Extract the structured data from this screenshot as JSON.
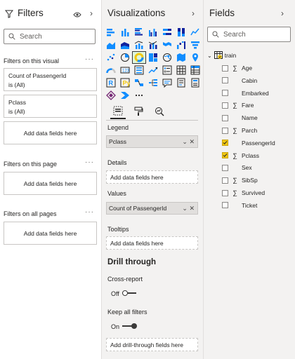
{
  "filters": {
    "title": "Filters",
    "search_placeholder": "Search",
    "sections": {
      "on_visual": "Filters on this visual",
      "on_page": "Filters on this page",
      "on_all_pages": "Filters on all pages"
    },
    "cards": [
      {
        "field": "Count of PassengerId",
        "state": "is (All)"
      },
      {
        "field": "Pclass",
        "state": "is (All)"
      }
    ],
    "add_fields": "Add data fields here"
  },
  "viz": {
    "title": "Visualizations",
    "legend_label": "Legend",
    "legend_value": "Pclass",
    "details_label": "Details",
    "details_placeholder": "Add data fields here",
    "values_label": "Values",
    "values_value": "Count of PassengerId",
    "tooltips_label": "Tooltips",
    "tooltips_placeholder": "Add data fields here",
    "drill_title": "Drill through",
    "cross_report_label": "Cross-report",
    "cross_report_state": "Off",
    "keep_filters_label": "Keep all filters",
    "keep_filters_state": "On",
    "drill_placeholder": "Add drill-through fields here",
    "more": "...",
    "selected_visual": "donut"
  },
  "fields": {
    "title": "Fields",
    "search_placeholder": "Search",
    "table": "train",
    "items": [
      {
        "name": "Age",
        "sigma": true,
        "checked": false
      },
      {
        "name": "Cabin",
        "sigma": false,
        "checked": false
      },
      {
        "name": "Embarked",
        "sigma": false,
        "checked": false
      },
      {
        "name": "Fare",
        "sigma": true,
        "checked": false
      },
      {
        "name": "Name",
        "sigma": false,
        "checked": false
      },
      {
        "name": "Parch",
        "sigma": true,
        "checked": false
      },
      {
        "name": "PassengerId",
        "sigma": false,
        "checked": true
      },
      {
        "name": "Pclass",
        "sigma": true,
        "checked": true
      },
      {
        "name": "Sex",
        "sigma": false,
        "checked": false
      },
      {
        "name": "SibSp",
        "sigma": true,
        "checked": false
      },
      {
        "name": "Survived",
        "sigma": true,
        "checked": false
      },
      {
        "name": "Ticket",
        "sigma": false,
        "checked": false
      }
    ]
  },
  "colors": {
    "accent": "#f2c811",
    "toggle_on": "#3b3a39",
    "viz_teal": "#118dff"
  }
}
